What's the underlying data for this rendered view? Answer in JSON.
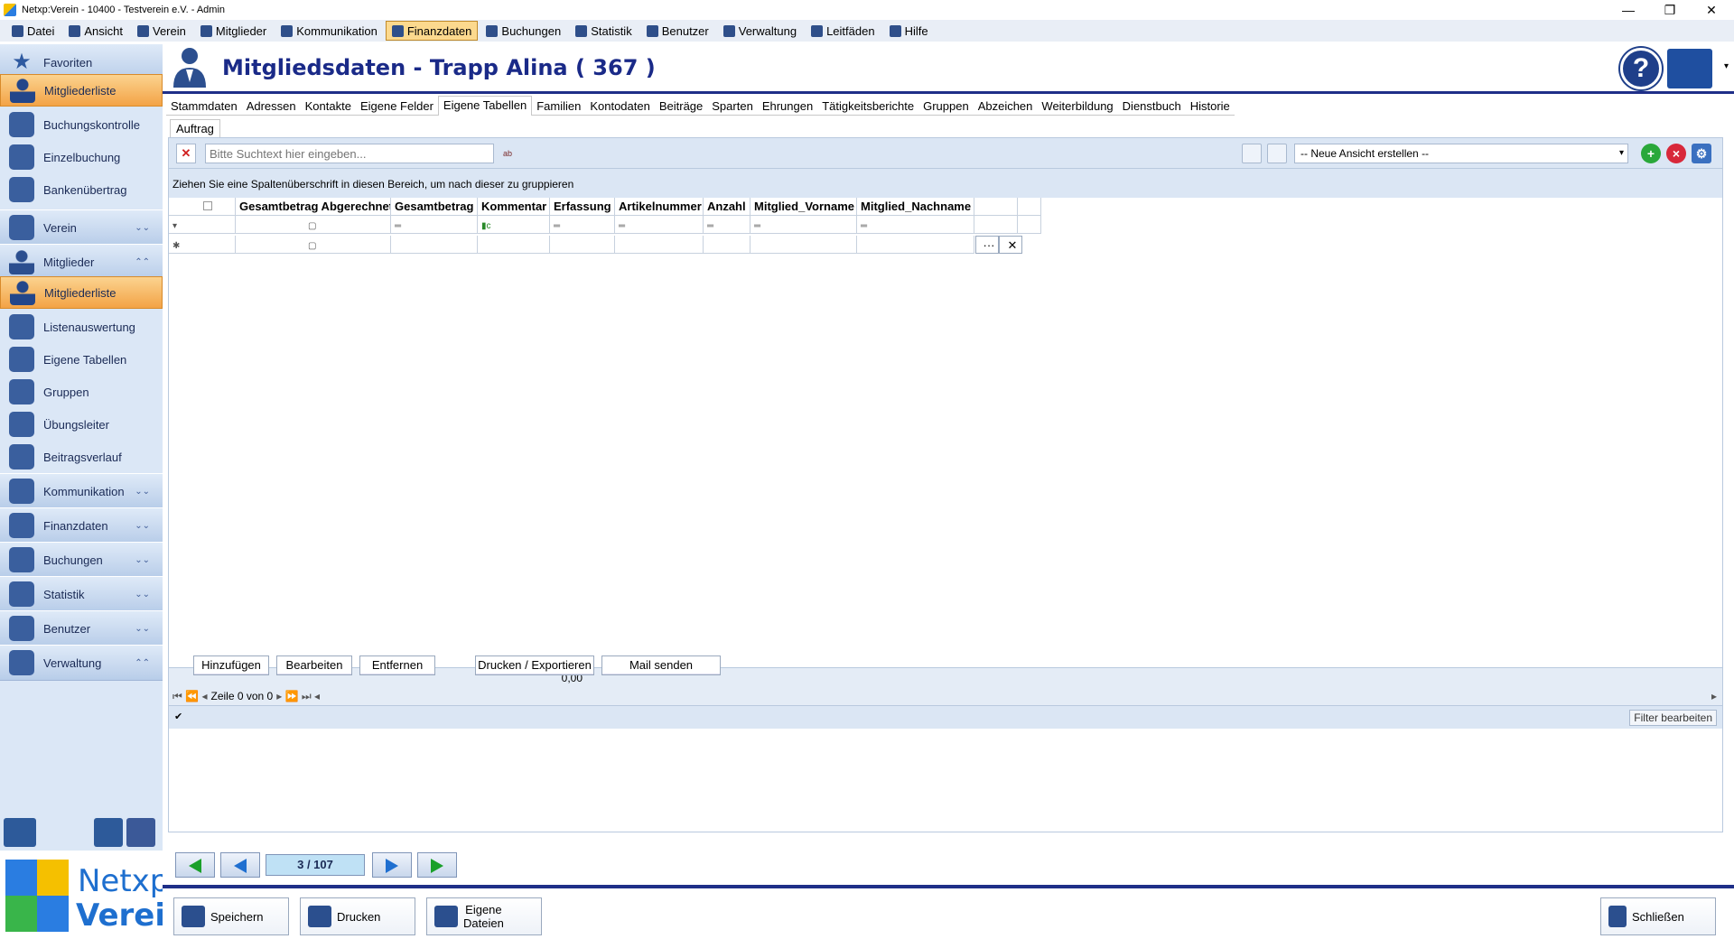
{
  "titlebar": {
    "title": "Netxp:Verein - 10400 - Testverein e.V. - Admin"
  },
  "menu": [
    {
      "label": "Datei",
      "icon": "floppy-icon"
    },
    {
      "label": "Ansicht",
      "icon": "phone-icon"
    },
    {
      "label": "Verein",
      "icon": "house-icon"
    },
    {
      "label": "Mitglieder",
      "icon": "person-icon"
    },
    {
      "label": "Kommunikation",
      "icon": "envelope-icon"
    },
    {
      "label": "Finanzdaten",
      "icon": "money-bag-icon",
      "active": true
    },
    {
      "label": "Buchungen",
      "icon": "register-icon"
    },
    {
      "label": "Statistik",
      "icon": "bar-chart-icon"
    },
    {
      "label": "Benutzer",
      "icon": "user-icon"
    },
    {
      "label": "Verwaltung",
      "icon": "tools-icon"
    },
    {
      "label": "Leitfäden",
      "icon": "info-icon"
    },
    {
      "label": "Hilfe",
      "icon": "question-icon"
    }
  ],
  "sidebar": {
    "items": [
      {
        "label": "Favoriten",
        "type": "big",
        "icon": "star-icon"
      },
      {
        "label": "Mitgliederliste",
        "type": "sel",
        "icon": "person-icon"
      },
      {
        "label": "Buchungskontrolle",
        "type": "sub",
        "icon": "monitor-icon"
      },
      {
        "label": "Einzelbuchung",
        "type": "sub",
        "icon": "hierarchy-icon"
      },
      {
        "label": "Bankenübertrag",
        "type": "sub",
        "icon": "transfer-icon"
      },
      {
        "label": "Verein",
        "type": "big",
        "icon": "house-icon",
        "chevron": "down"
      },
      {
        "label": "Mitglieder",
        "type": "big",
        "icon": "person-icon",
        "chevron": "up"
      },
      {
        "label": "Mitgliederliste",
        "type": "sel",
        "icon": "person-icon"
      },
      {
        "label": "Listenauswertung",
        "type": "sub",
        "icon": "list-icon"
      },
      {
        "label": "Eigene Tabellen",
        "type": "sub",
        "icon": "tables-icon"
      },
      {
        "label": "Gruppen",
        "type": "sub",
        "icon": "group-icon"
      },
      {
        "label": "Übungsleiter",
        "type": "sub",
        "icon": "trainer-icon"
      },
      {
        "label": "Beitragsverlauf",
        "type": "sub",
        "icon": "money-bag-icon"
      },
      {
        "label": "Kommunikation",
        "type": "big",
        "icon": "envelope-icon",
        "chevron": "down"
      },
      {
        "label": "Finanzdaten",
        "type": "big",
        "icon": "euro-icon",
        "chevron": "down"
      },
      {
        "label": "Buchungen",
        "type": "big",
        "icon": "register-icon",
        "chevron": "down"
      },
      {
        "label": "Statistik",
        "type": "big",
        "icon": "bar-chart-icon",
        "chevron": "down"
      },
      {
        "label": "Benutzer",
        "type": "big",
        "icon": "user-icon",
        "chevron": "down"
      },
      {
        "label": "Verwaltung",
        "type": "big",
        "icon": "tools-icon",
        "chevron": "up"
      }
    ]
  },
  "logo": {
    "line1": "Netxp",
    "line2": "Verein"
  },
  "header": {
    "title": "Mitgliedsdaten - Trapp Alina ( 367 )"
  },
  "tabs": [
    "Stammdaten",
    "Adressen",
    "Kontakte",
    "Eigene Felder",
    "Eigene Tabellen",
    "Familien",
    "Kontodaten",
    "Beiträge",
    "Sparten",
    "Ehrungen",
    "Tätigkeitsberichte",
    "Gruppen",
    "Abzeichen",
    "Weiterbildung",
    "Dienstbuch",
    "Historie"
  ],
  "active_tab": 4,
  "subtab": "Auftrag",
  "toolbar": {
    "search_placeholder": "Bitte Suchtext hier eingeben...",
    "spell_label": "ab",
    "view_select": "-- Neue Ansicht erstellen --"
  },
  "group_hint": "Ziehen Sie eine Spaltenüberschrift in diesen Bereich, um nach dieser zu gruppieren",
  "grid": {
    "columns": [
      "Gesamtbetrag Abgerechnet",
      "Gesamtbetrag",
      "Kommentar",
      "Erfassung",
      "Artikelnummer",
      "Anzahl",
      "Mitglied_Vorname",
      "Mitglied_Nachname"
    ],
    "rows": []
  },
  "summary": {
    "total": "0,00"
  },
  "pager": {
    "text": "Zeile 0 von 0"
  },
  "filter": {
    "button": "Filter bearbeiten",
    "checked": true
  },
  "actions": {
    "add": "Hinzufügen",
    "edit": "Bearbeiten",
    "remove": "Entfernen",
    "print_export": "Drucken / Exportieren",
    "mail": "Mail senden"
  },
  "navigation": {
    "position": "3 / 107"
  },
  "bottom": {
    "save": "Speichern",
    "print": "Drucken",
    "files_line1": "Eigene",
    "files_line2": "Dateien",
    "close": "Schließen"
  },
  "colors": {
    "accent": "#1f2f88",
    "selected": "#f3a346",
    "sidebar": "#dbe7f6"
  }
}
